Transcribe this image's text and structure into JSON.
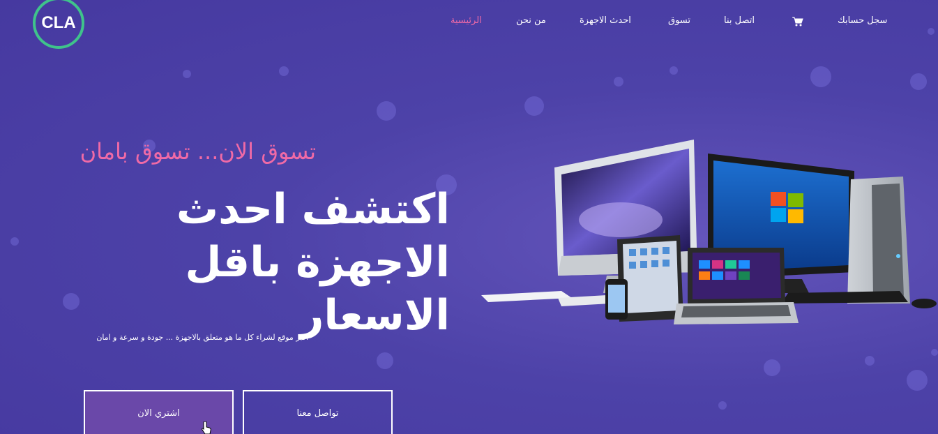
{
  "logo": {
    "text": "CLA"
  },
  "nav": {
    "register": "سجل حسابك",
    "cart_icon": "cart-icon",
    "contact": "اتصل بنا",
    "shop": "تسوق",
    "latest": "احدث الاجهزة",
    "about": "من نحن",
    "home": "الرئيسية"
  },
  "hero": {
    "tagline": "تسوق الان... تسوق بامان",
    "headline_line1": "اكتشف احدث",
    "headline_line2": "الاجهزة باقل الاسعار",
    "subtext": "اكبر موقع لشراء كل ما هو متعلق بالاجهزة ... جودة و سرعة و امان",
    "buy_button": "اشتري الان",
    "contact_button": "تواصل معنا"
  },
  "colors": {
    "background": "#4a3fa3",
    "accent_pink": "#f06aa6",
    "logo_ring": "#3fc38b",
    "buy_button_bg": "#6a48a9"
  }
}
